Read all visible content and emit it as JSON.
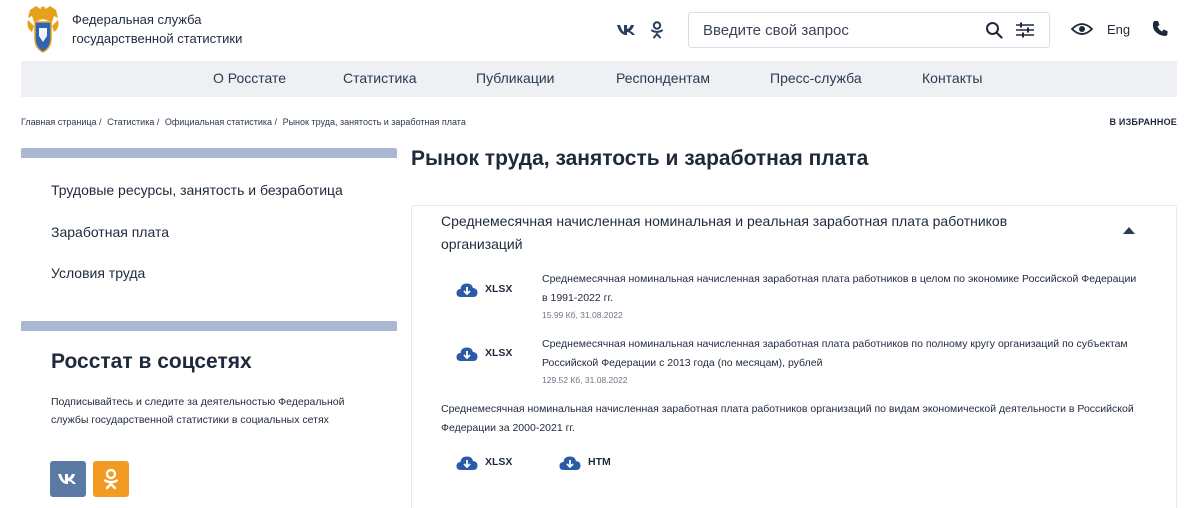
{
  "header": {
    "brand_line1": "Федеральная служба",
    "brand_line2": "государственной статистики",
    "vk_label": "vk",
    "search_placeholder": "Введите свой запрос",
    "lang": "Eng"
  },
  "nav": [
    "О Росстате",
    "Статистика",
    "Публикации",
    "Респондентам",
    "Пресс-служба",
    "Контакты"
  ],
  "breadcrumb": [
    "Главная страница /",
    "Статистика /",
    "Официальная статистика /",
    "Рынок труда, занятость и заработная плата"
  ],
  "favorite": "В ИЗБРАННОЕ",
  "sidebar": {
    "items": [
      "Трудовые ресурсы, занятость и безработица",
      "Заработная плата",
      "Условия труда"
    ],
    "social_title": "Росстат в соцсетях",
    "social_text": "Подписывайтесь и следите за деятельностью Федеральной службы государственной статистики в социальных сетях"
  },
  "main": {
    "title": "Рынок труда, занятость и заработная плата",
    "section_title": "Среднемесячная начисленная номинальная и реальная заработная плата работников организаций",
    "files": [
      {
        "format": "XLSX",
        "title": "Среднемесячная номинальная начисленная заработная плата работников в целом по экономике Российской Федерации в 1991-2022 гг.",
        "meta": "15.99 Кб, 31.08.2022"
      },
      {
        "format": "XLSX",
        "title": "Среднемесячная номинальная начисленная заработная плата работников по полному кругу организаций по субъектам Российской Федерации с 2013 года (по месяцам), рублей",
        "meta": "129.52 Кб, 31.08.2022"
      }
    ],
    "plain_title": "Среднемесячная номинальная начисленная заработная плата работников организаций по видам экономической деятельности в Российской Федерации за 2000-2021 гг.",
    "plain_formats": [
      "XLSX",
      "HTM"
    ]
  },
  "colors": {
    "accent": "#2b4a80",
    "nav_bg": "#eef0f4",
    "sidebar_bar": "#aab7d1",
    "vk": "#5a7aa3",
    "ok": "#f29a22"
  },
  "icons": [
    "coat-of-arms-logo",
    "vk-icon",
    "ok-icon",
    "search-icon",
    "filter-icon",
    "eye-icon",
    "phone-icon",
    "caret-up-icon",
    "cloud-download-icon"
  ]
}
